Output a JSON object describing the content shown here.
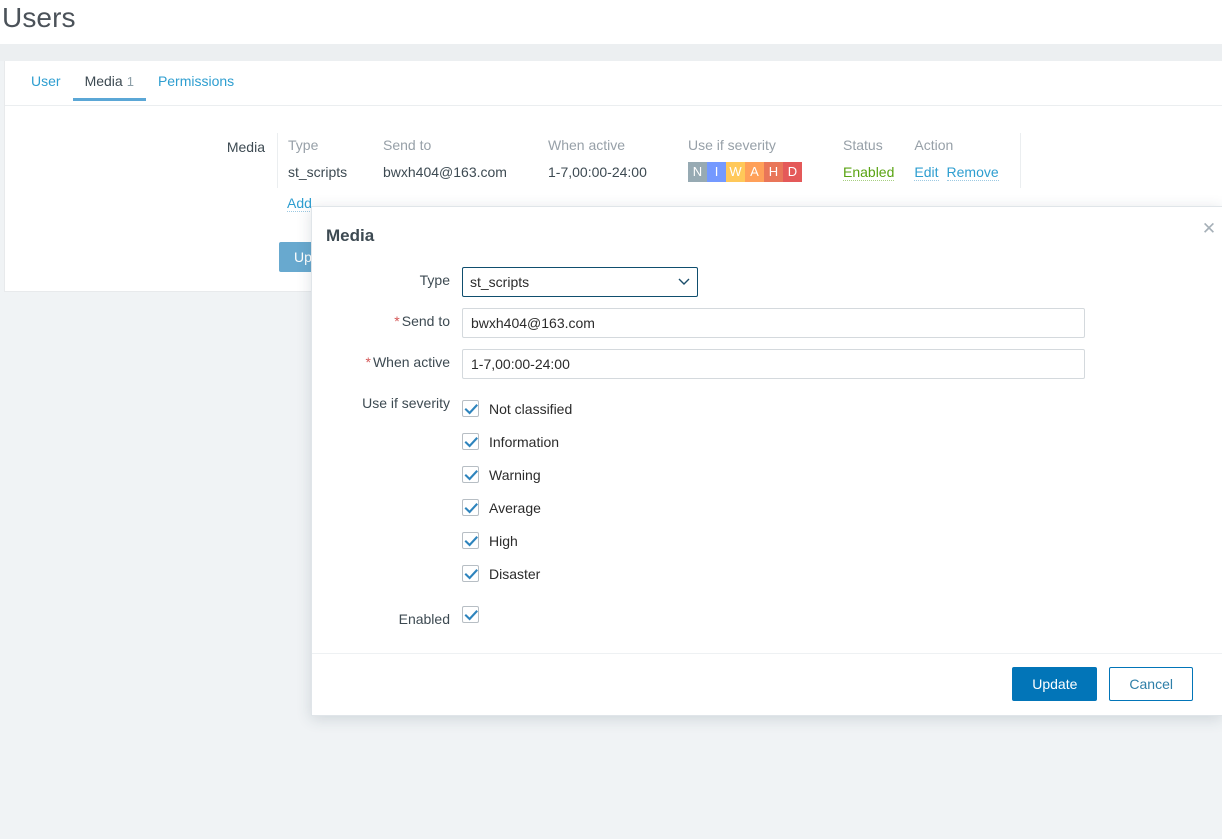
{
  "page": {
    "title": "Users"
  },
  "tabs": [
    {
      "label": "User",
      "count": "",
      "active": false
    },
    {
      "label": "Media",
      "count": "1",
      "active": true
    },
    {
      "label": "Permissions",
      "count": "",
      "active": false
    }
  ],
  "media_section": {
    "label": "Media",
    "columns": [
      "Type",
      "Send to",
      "When active",
      "Use if severity",
      "Status",
      "Action"
    ],
    "rows": [
      {
        "type": "st_scripts",
        "send_to": "bwxh404@163.com",
        "when_active": "1-7,00:00-24:00",
        "severity": [
          {
            "letter": "N",
            "color": "#97aab3"
          },
          {
            "letter": "I",
            "color": "#7499ff"
          },
          {
            "letter": "W",
            "color": "#ffc859"
          },
          {
            "letter": "A",
            "color": "#ffa059"
          },
          {
            "letter": "H",
            "color": "#e97659"
          },
          {
            "letter": "D",
            "color": "#e45959"
          }
        ],
        "status": "Enabled",
        "actions": [
          "Edit",
          "Remove"
        ]
      }
    ],
    "add_label": "Add",
    "update_label": "Update"
  },
  "modal": {
    "title": "Media",
    "close_icon": "close-icon",
    "type": {
      "label": "Type",
      "value": "st_scripts",
      "options": [
        "st_scripts"
      ],
      "required": false
    },
    "send_to": {
      "label": "Send to",
      "value": "bwxh404@163.com",
      "placeholder": "",
      "required": true
    },
    "when_active": {
      "label": "When active",
      "value": "1-7,00:00-24:00",
      "placeholder": "",
      "required": true
    },
    "severity": {
      "label": "Use if severity",
      "items": [
        {
          "label": "Not classified",
          "checked": true
        },
        {
          "label": "Information",
          "checked": true
        },
        {
          "label": "Warning",
          "checked": true
        },
        {
          "label": "Average",
          "checked": true
        },
        {
          "label": "High",
          "checked": true
        },
        {
          "label": "Disaster",
          "checked": true
        }
      ]
    },
    "enabled": {
      "label": "Enabled",
      "checked": true
    },
    "buttons": {
      "update": "Update",
      "cancel": "Cancel"
    }
  },
  "colors": {
    "accent": "#0275b8",
    "link": "#2e9ed0",
    "green": "#59a312",
    "required": "#d45757"
  }
}
